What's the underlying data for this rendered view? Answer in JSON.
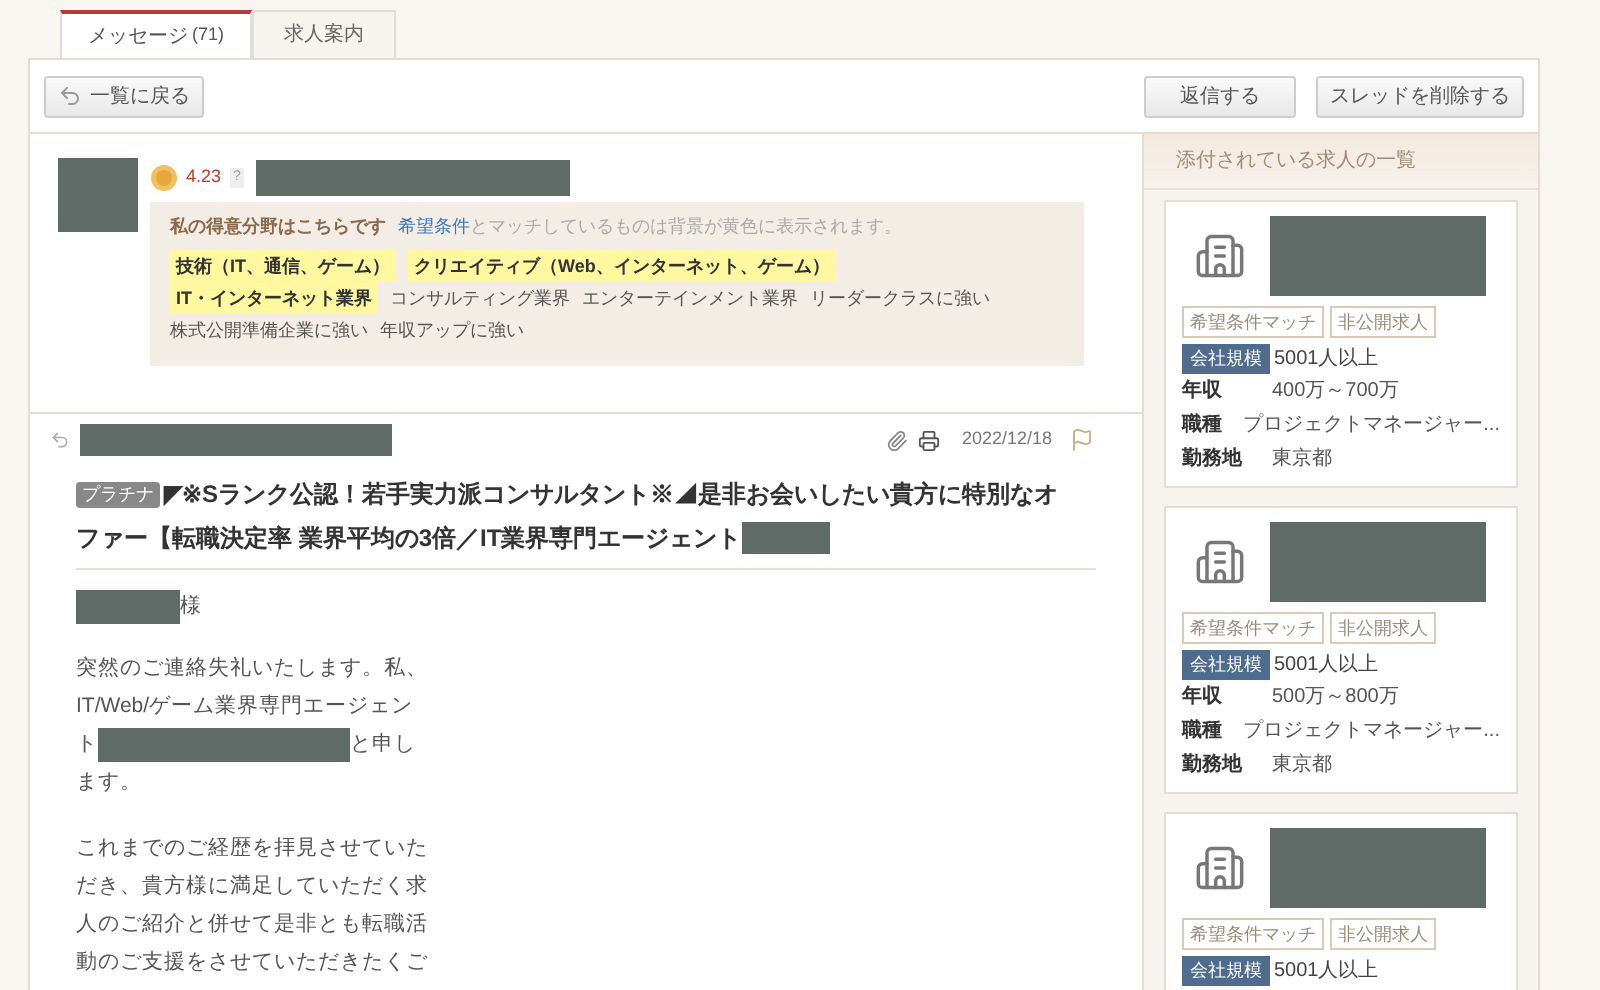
{
  "tabs": [
    {
      "label": "メッセージ",
      "count": "(71)",
      "selected": true
    },
    {
      "label": "求人案内",
      "selected": false
    }
  ],
  "toolbar": {
    "back_button": "一覧に戻る",
    "buttons": [
      "返信する",
      "スレッドを削除する"
    ]
  },
  "sender": {
    "rating": "4.23",
    "help": "?",
    "specialties": {
      "title": "私の得意分野はこちらです",
      "link": "希望条件",
      "note": "とマッチしているものは背景が黄色に表示されます。",
      "tags": [
        {
          "label": "技術（IT、通信、ゲーム）",
          "matched": true
        },
        {
          "label": "クリエイティブ（Web、インターネット、ゲーム）",
          "matched": true
        },
        {
          "label": "IT・インターネット業界",
          "matched": true
        },
        {
          "label": "コンサルティング業界",
          "matched": false
        },
        {
          "label": "エンターテインメント業界",
          "matched": false
        },
        {
          "label": "リーダークラスに強い",
          "matched": false
        },
        {
          "label": "株式公開準備企業に強い",
          "matched": false
        },
        {
          "label": "年収アップに強い",
          "matched": false
        }
      ]
    }
  },
  "message": {
    "date": "2022/12/18",
    "badge": "プラチナ",
    "subject_lines": [
      "◤※Sランク公認！若手実力派コンサルタント※◢是非お会いしたい貴方に特別なオ",
      "ファー【転職決定率 業界平均の3倍／IT業界専門エージェント"
    ],
    "salutation": "様",
    "paragraphs": [
      [
        [
          "突然のご連絡失礼いたします。私、"
        ],
        [
          "IT/Web/ゲーム業界専門エージェン"
        ],
        [
          "ト",
          "と申し"
        ],
        [
          "ます。"
        ]
      ],
      [
        [
          "これまでのご経歴を拝見させていた"
        ],
        [
          "だき、貴方様に満足していただく求"
        ],
        [
          "人のご紹介と併せて是非とも転職活"
        ],
        [
          "動のご支援をさせていただきたくご"
        ]
      ]
    ]
  },
  "sidebar": {
    "title": "添付されている求人の一覧",
    "jobs": [
      {
        "tags": [
          "希望条件マッチ",
          "非公開求人"
        ],
        "size_label": "会社規模",
        "size": "5001人以上",
        "details": [
          [
            "年収",
            "400万～700万"
          ],
          [
            "職種",
            "プロジェクトマネージャー..."
          ],
          [
            "勤務地",
            "東京都"
          ]
        ]
      },
      {
        "tags": [
          "希望条件マッチ",
          "非公開求人"
        ],
        "size_label": "会社規模",
        "size": "5001人以上",
        "details": [
          [
            "年収",
            "500万～800万"
          ],
          [
            "職種",
            "プロジェクトマネージャー..."
          ],
          [
            "勤務地",
            "東京都"
          ]
        ]
      },
      {
        "tags": [
          "希望条件マッチ",
          "非公開求人"
        ],
        "size_label": "会社規模",
        "size": "5001人以上"
      }
    ]
  }
}
